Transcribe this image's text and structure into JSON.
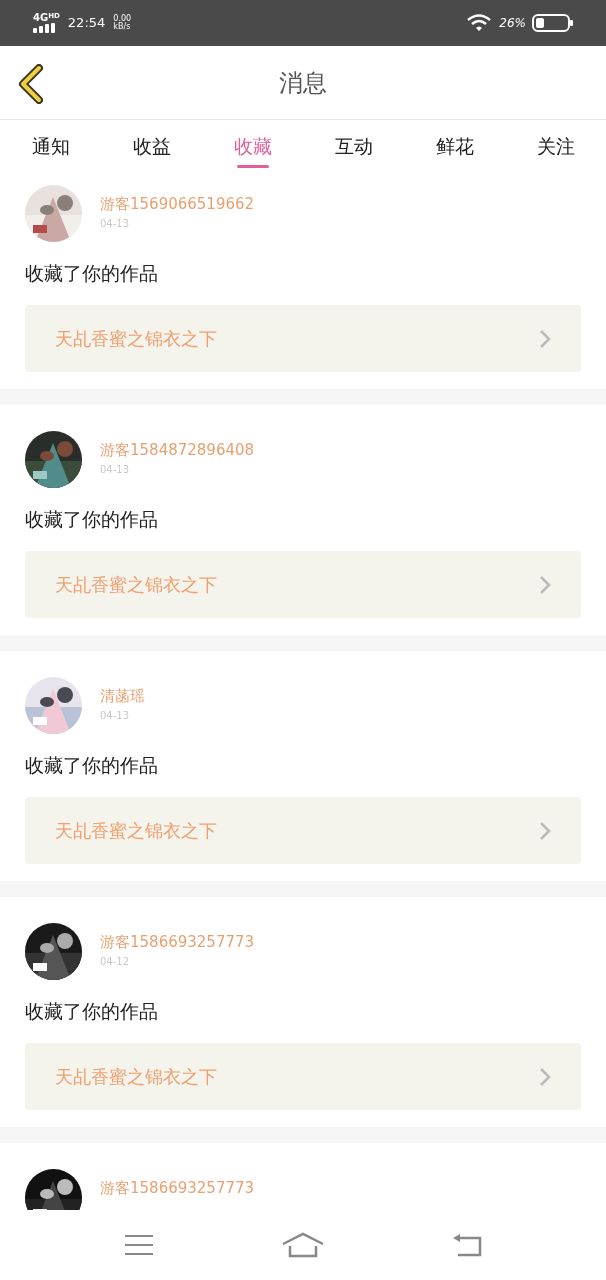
{
  "status_bar": {
    "network": "4G",
    "network_sup": "HD",
    "time": "22:54",
    "speed_value": "0.00",
    "speed_unit": "kB/s",
    "battery": "26%"
  },
  "header": {
    "title": "消息"
  },
  "tabs": [
    {
      "label": "通知",
      "selected": false
    },
    {
      "label": "收益",
      "selected": false
    },
    {
      "label": "收藏",
      "selected": true
    },
    {
      "label": "互动",
      "selected": false
    },
    {
      "label": "鲜花",
      "selected": false
    },
    {
      "label": "关注",
      "selected": false
    }
  ],
  "messages": [
    {
      "name": "游客1569066519662",
      "date": "04-13",
      "text": "收藏了你的作品",
      "work": "天乩香蜜之锦衣之下"
    },
    {
      "name": "游客1584872896408",
      "date": "04-13",
      "text": "收藏了你的作品",
      "work": "天乩香蜜之锦衣之下"
    },
    {
      "name": "清菡瑶",
      "date": "04-13",
      "text": "收藏了你的作品",
      "work": "天乩香蜜之锦衣之下"
    },
    {
      "name": "游客1586693257773",
      "date": "04-12",
      "text": "收藏了你的作品",
      "work": "天乩香蜜之锦衣之下"
    },
    {
      "name": "游客1586693257773"
    }
  ]
}
